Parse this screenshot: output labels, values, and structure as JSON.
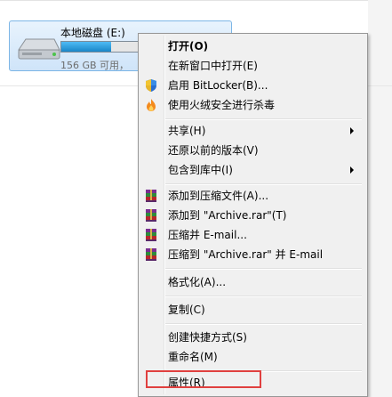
{
  "drive": {
    "name": "本地磁盘 (E:)",
    "free_text": "156 GB 可用，",
    "used_fraction": 0.3
  },
  "menu": {
    "items": [
      {
        "label": "打开(O)"
      },
      {
        "label": "在新窗口中打开(E)"
      },
      {
        "label": "启用 BitLocker(B)..."
      },
      {
        "label": "使用火绒安全进行杀毒"
      },
      {
        "label": "共享(H)"
      },
      {
        "label": "还原以前的版本(V)"
      },
      {
        "label": "包含到库中(I)"
      },
      {
        "label": "添加到压缩文件(A)..."
      },
      {
        "label": "添加到 \"Archive.rar\"(T)"
      },
      {
        "label": "压缩并 E-mail..."
      },
      {
        "label": "压缩到 \"Archive.rar\" 并 E-mail"
      },
      {
        "label": "格式化(A)..."
      },
      {
        "label": "复制(C)"
      },
      {
        "label": "创建快捷方式(S)"
      },
      {
        "label": "重命名(M)"
      },
      {
        "label": "属性(R)"
      }
    ]
  },
  "colors": {
    "highlight_border": "#e0403f",
    "drive_bar_fill": "#1a86c8"
  }
}
